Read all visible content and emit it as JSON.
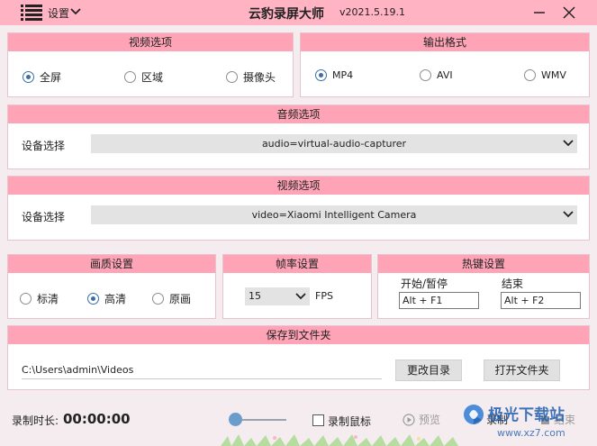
{
  "titlebar": {
    "settings_label": "设置",
    "title": "云豹录屏大师",
    "version": "v2021.5.19.1"
  },
  "video_options": {
    "header": "视频选项",
    "options": [
      {
        "label": "全屏",
        "selected": true
      },
      {
        "label": "区域",
        "selected": false
      },
      {
        "label": "摄像头",
        "selected": false
      }
    ]
  },
  "output_format": {
    "header": "输出格式",
    "options": [
      {
        "label": "MP4",
        "selected": true
      },
      {
        "label": "AVI",
        "selected": false
      },
      {
        "label": "WMV",
        "selected": false
      }
    ]
  },
  "audio_options": {
    "header": "音频选项",
    "device_label": "设备选择",
    "device_value": "audio=virtual-audio-capturer"
  },
  "video_device": {
    "header": "视频选项",
    "device_label": "设备选择",
    "device_value": "video=Xiaomi Intelligent Camera"
  },
  "quality": {
    "header": "画质设置",
    "options": [
      {
        "label": "标清",
        "selected": false
      },
      {
        "label": "高清",
        "selected": true
      },
      {
        "label": "原画",
        "selected": false
      }
    ]
  },
  "framerate": {
    "header": "帧率设置",
    "value": "15",
    "unit": "FPS"
  },
  "hotkeys": {
    "header": "热键设置",
    "start_label": "开始/暂停",
    "start_value": "Alt + F1",
    "end_label": "结束",
    "end_value": "Alt + F2"
  },
  "save_folder": {
    "header": "保存到文件夹",
    "path": "C:\\Users\\admin\\Videos",
    "change_button": "更改目录",
    "open_button": "打开文件夹"
  },
  "bottom": {
    "duration_label": "录制时长:",
    "duration_value": "00:00:00",
    "record_mouse_label": "录制鼠标",
    "preview_label": "预览",
    "record_label": "录制",
    "end_label": "结束"
  },
  "watermark": {
    "text": "极光下载站",
    "url": "www.xz7.com"
  },
  "colors": {
    "titlebar": "#ffb3c3",
    "panel_header": "#ffa3b7",
    "radio_selected": "#3a6ea5"
  }
}
